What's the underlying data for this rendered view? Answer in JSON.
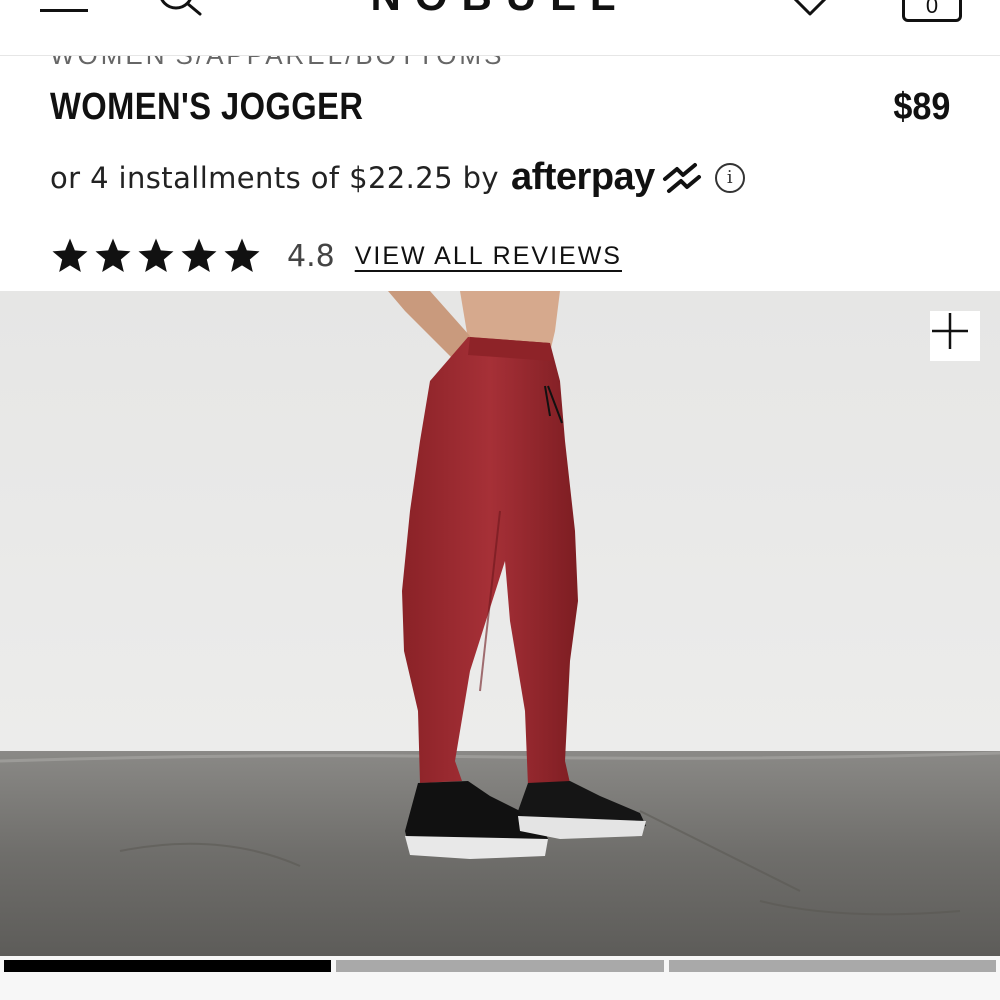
{
  "header": {
    "logo_text": "NOBULL",
    "menu_icon": "hamburger-icon",
    "search_icon": "search-icon",
    "wishlist_icon": "heart-icon",
    "cart_icon": "bag-icon",
    "cart_count": "0"
  },
  "breadcrumb": {
    "items": [
      "WOMEN'S",
      "APPAREL",
      "BOTTOMS"
    ],
    "separator": " / "
  },
  "product": {
    "title": "WOMEN'S JOGGER",
    "price": "$89",
    "installments_text": "or 4 installments of $22.25 by",
    "payment_brand": "afterpay",
    "info_icon": "info-icon",
    "rating": {
      "value": "4.8",
      "stars_filled": 5,
      "max_stars": 5,
      "reviews_link": "VIEW ALL REVIEWS"
    }
  },
  "gallery": {
    "zoom_icon": "plus-icon",
    "slide_count": 3,
    "active_slide": 1
  },
  "colors": {
    "text": "#111111",
    "muted": "#666666",
    "jogger": "#9e2b30",
    "indicator_active": "#000000",
    "indicator_inactive": "#a9a9a9"
  }
}
